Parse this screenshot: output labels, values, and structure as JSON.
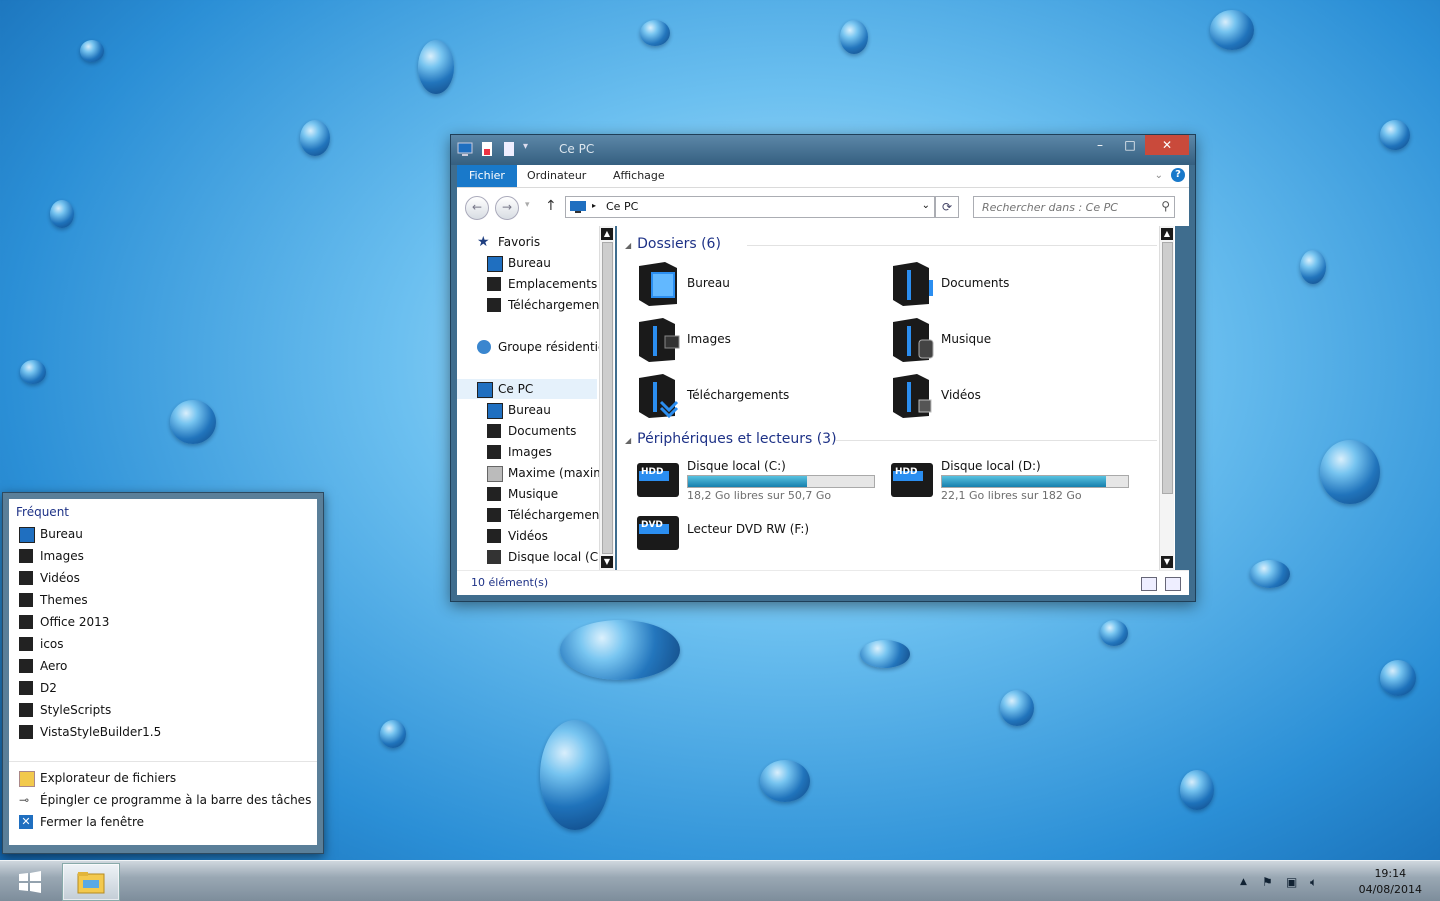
{
  "window": {
    "title": "Ce PC",
    "ribbon_tabs": [
      "Fichier",
      "Ordinateur",
      "Affichage"
    ],
    "address_path": "Ce PC",
    "search_placeholder": "Rechercher dans : Ce PC",
    "status": "10 élément(s)"
  },
  "nav_pane": {
    "favorites_label": "Favoris",
    "favorites": [
      "Bureau",
      "Emplacements ré",
      "Téléchargements"
    ],
    "homegroup_label": "Groupe résidentiel",
    "this_pc_label": "Ce PC",
    "this_pc_items": [
      "Bureau",
      "Documents",
      "Images",
      "Maxime (maxime",
      "Musique",
      "Téléchargements",
      "Vidéos",
      "Disque local (C:)"
    ]
  },
  "content": {
    "folders_header": "Dossiers (6)",
    "folders": [
      "Bureau",
      "Documents",
      "Images",
      "Musique",
      "Téléchargements",
      "Vidéos"
    ],
    "devices_header": "Périphériques et lecteurs (3)",
    "drives": [
      {
        "name": "Disque local (C:)",
        "badge": "HDD",
        "free": "18,2 Go libres sur 50,7 Go",
        "used_fraction": 0.64
      },
      {
        "name": "Disque local (D:)",
        "badge": "HDD",
        "free": "22,1 Go libres sur 182 Go",
        "used_fraction": 0.88
      }
    ],
    "dvd": {
      "name": "Lecteur DVD RW (F:)",
      "badge": "DVD"
    }
  },
  "jumplist": {
    "header": "Fréquent",
    "items": [
      "Bureau",
      "Images",
      "Vidéos",
      "Themes",
      "Office 2013",
      "icos",
      "Aero",
      "D2",
      "StyleScripts",
      "VistaStyleBuilder1.5"
    ],
    "tasks": [
      "Explorateur de fichiers",
      "Épingler ce programme à la barre des tâches",
      "Fermer la fenêtre"
    ]
  },
  "taskbar": {
    "time": "19:14",
    "date": "04/08/2014"
  },
  "colors": {
    "accent": "#1979ca",
    "group_header": "#1e3287",
    "drive_bar": "#1f8fbd"
  }
}
